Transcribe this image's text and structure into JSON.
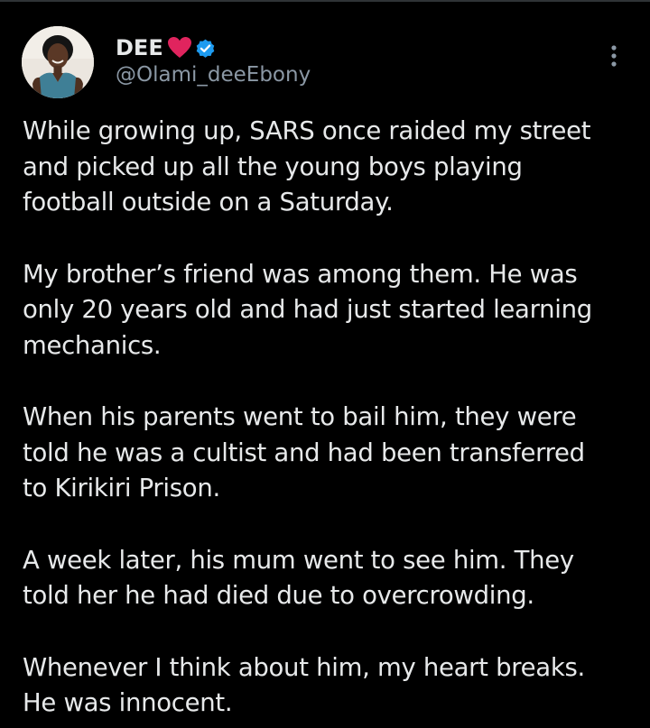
{
  "tweet": {
    "author": {
      "display_name": "DEE",
      "name_emoji": "red-heart-icon",
      "verified_badge": "verified-icon",
      "handle": "@Olami_deeEbony"
    },
    "more_icon": "more-options-icon",
    "paragraphs": [
      {
        "lines": [
          "While growing up, SARS once raided my street",
          "and picked up all the young boys playing",
          "football outside on a Saturday."
        ]
      },
      {
        "lines": [
          "My brother’s friend was among them. He was",
          "only 20 years old and had just started learning",
          "mechanics."
        ]
      },
      {
        "lines": [
          "When his parents went to bail him, they were",
          "told he was a cultist and had been transferred",
          "to Kirikiri Prison."
        ]
      },
      {
        "lines": [
          "A week later, his mum went to see him. They",
          "told her he had died due to overcrowding."
        ]
      },
      {
        "lines": [
          "Whenever I think about him, my heart breaks.",
          "He was innocent."
        ]
      }
    ]
  },
  "colors": {
    "background": "#000000",
    "primary_text": "#e7e9ea",
    "secondary_text": "#8b98a5",
    "verified_blue": "#1d9bf0",
    "heart_red": "#e0245e"
  }
}
